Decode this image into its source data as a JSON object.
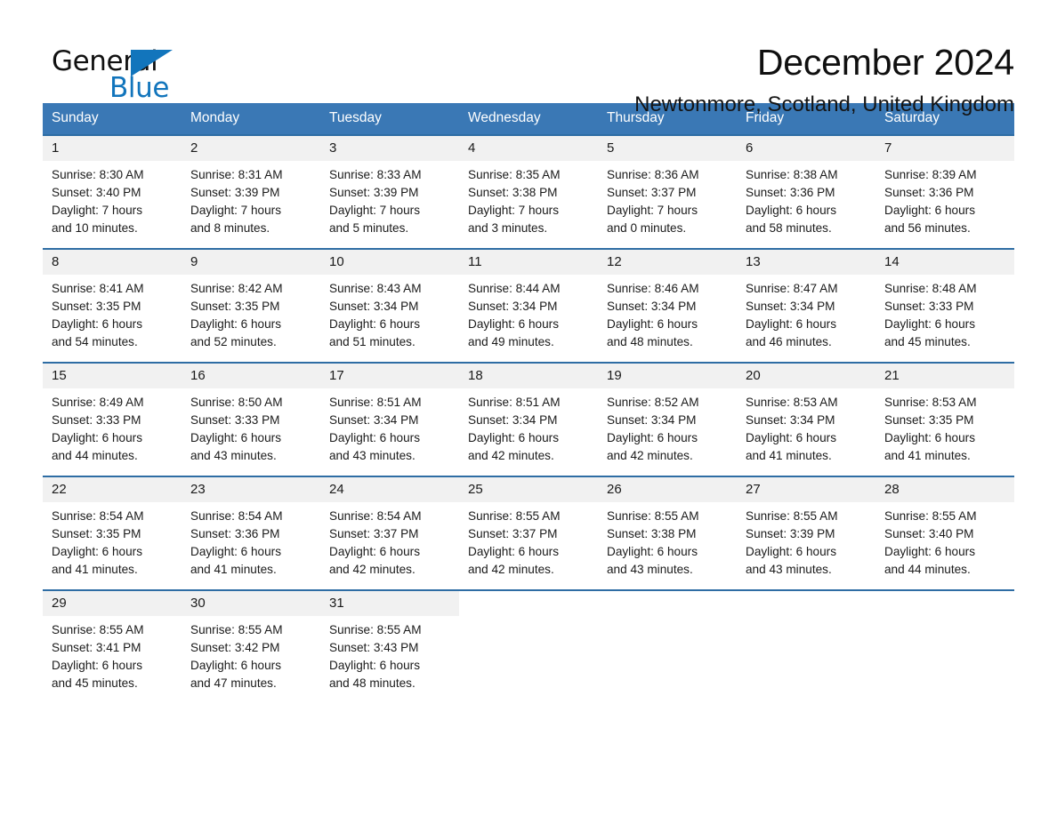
{
  "brand": {
    "name_top": "General",
    "name_bottom": "Blue",
    "accent_color": "#1275bc"
  },
  "header": {
    "title": "December 2024",
    "subtitle": "Newtonmore, Scotland, United Kingdom"
  },
  "theme": {
    "header_blue": "#3a78b5",
    "row_divider_blue": "#2e6da4",
    "date_band_gray": "#f1f1f1"
  },
  "calendar": {
    "weekdays": [
      "Sunday",
      "Monday",
      "Tuesday",
      "Wednesday",
      "Thursday",
      "Friday",
      "Saturday"
    ],
    "weeks": [
      {
        "days": [
          {
            "date": "1",
            "sunrise": "Sunrise: 8:30 AM",
            "sunset": "Sunset: 3:40 PM",
            "daylight_line1": "Daylight: 7 hours",
            "daylight_line2": "and 10 minutes."
          },
          {
            "date": "2",
            "sunrise": "Sunrise: 8:31 AM",
            "sunset": "Sunset: 3:39 PM",
            "daylight_line1": "Daylight: 7 hours",
            "daylight_line2": "and 8 minutes."
          },
          {
            "date": "3",
            "sunrise": "Sunrise: 8:33 AM",
            "sunset": "Sunset: 3:39 PM",
            "daylight_line1": "Daylight: 7 hours",
            "daylight_line2": "and 5 minutes."
          },
          {
            "date": "4",
            "sunrise": "Sunrise: 8:35 AM",
            "sunset": "Sunset: 3:38 PM",
            "daylight_line1": "Daylight: 7 hours",
            "daylight_line2": "and 3 minutes."
          },
          {
            "date": "5",
            "sunrise": "Sunrise: 8:36 AM",
            "sunset": "Sunset: 3:37 PM",
            "daylight_line1": "Daylight: 7 hours",
            "daylight_line2": "and 0 minutes."
          },
          {
            "date": "6",
            "sunrise": "Sunrise: 8:38 AM",
            "sunset": "Sunset: 3:36 PM",
            "daylight_line1": "Daylight: 6 hours",
            "daylight_line2": "and 58 minutes."
          },
          {
            "date": "7",
            "sunrise": "Sunrise: 8:39 AM",
            "sunset": "Sunset: 3:36 PM",
            "daylight_line1": "Daylight: 6 hours",
            "daylight_line2": "and 56 minutes."
          }
        ]
      },
      {
        "days": [
          {
            "date": "8",
            "sunrise": "Sunrise: 8:41 AM",
            "sunset": "Sunset: 3:35 PM",
            "daylight_line1": "Daylight: 6 hours",
            "daylight_line2": "and 54 minutes."
          },
          {
            "date": "9",
            "sunrise": "Sunrise: 8:42 AM",
            "sunset": "Sunset: 3:35 PM",
            "daylight_line1": "Daylight: 6 hours",
            "daylight_line2": "and 52 minutes."
          },
          {
            "date": "10",
            "sunrise": "Sunrise: 8:43 AM",
            "sunset": "Sunset: 3:34 PM",
            "daylight_line1": "Daylight: 6 hours",
            "daylight_line2": "and 51 minutes."
          },
          {
            "date": "11",
            "sunrise": "Sunrise: 8:44 AM",
            "sunset": "Sunset: 3:34 PM",
            "daylight_line1": "Daylight: 6 hours",
            "daylight_line2": "and 49 minutes."
          },
          {
            "date": "12",
            "sunrise": "Sunrise: 8:46 AM",
            "sunset": "Sunset: 3:34 PM",
            "daylight_line1": "Daylight: 6 hours",
            "daylight_line2": "and 48 minutes."
          },
          {
            "date": "13",
            "sunrise": "Sunrise: 8:47 AM",
            "sunset": "Sunset: 3:34 PM",
            "daylight_line1": "Daylight: 6 hours",
            "daylight_line2": "and 46 minutes."
          },
          {
            "date": "14",
            "sunrise": "Sunrise: 8:48 AM",
            "sunset": "Sunset: 3:33 PM",
            "daylight_line1": "Daylight: 6 hours",
            "daylight_line2": "and 45 minutes."
          }
        ]
      },
      {
        "days": [
          {
            "date": "15",
            "sunrise": "Sunrise: 8:49 AM",
            "sunset": "Sunset: 3:33 PM",
            "daylight_line1": "Daylight: 6 hours",
            "daylight_line2": "and 44 minutes."
          },
          {
            "date": "16",
            "sunrise": "Sunrise: 8:50 AM",
            "sunset": "Sunset: 3:33 PM",
            "daylight_line1": "Daylight: 6 hours",
            "daylight_line2": "and 43 minutes."
          },
          {
            "date": "17",
            "sunrise": "Sunrise: 8:51 AM",
            "sunset": "Sunset: 3:34 PM",
            "daylight_line1": "Daylight: 6 hours",
            "daylight_line2": "and 43 minutes."
          },
          {
            "date": "18",
            "sunrise": "Sunrise: 8:51 AM",
            "sunset": "Sunset: 3:34 PM",
            "daylight_line1": "Daylight: 6 hours",
            "daylight_line2": "and 42 minutes."
          },
          {
            "date": "19",
            "sunrise": "Sunrise: 8:52 AM",
            "sunset": "Sunset: 3:34 PM",
            "daylight_line1": "Daylight: 6 hours",
            "daylight_line2": "and 42 minutes."
          },
          {
            "date": "20",
            "sunrise": "Sunrise: 8:53 AM",
            "sunset": "Sunset: 3:34 PM",
            "daylight_line1": "Daylight: 6 hours",
            "daylight_line2": "and 41 minutes."
          },
          {
            "date": "21",
            "sunrise": "Sunrise: 8:53 AM",
            "sunset": "Sunset: 3:35 PM",
            "daylight_line1": "Daylight: 6 hours",
            "daylight_line2": "and 41 minutes."
          }
        ]
      },
      {
        "days": [
          {
            "date": "22",
            "sunrise": "Sunrise: 8:54 AM",
            "sunset": "Sunset: 3:35 PM",
            "daylight_line1": "Daylight: 6 hours",
            "daylight_line2": "and 41 minutes."
          },
          {
            "date": "23",
            "sunrise": "Sunrise: 8:54 AM",
            "sunset": "Sunset: 3:36 PM",
            "daylight_line1": "Daylight: 6 hours",
            "daylight_line2": "and 41 minutes."
          },
          {
            "date": "24",
            "sunrise": "Sunrise: 8:54 AM",
            "sunset": "Sunset: 3:37 PM",
            "daylight_line1": "Daylight: 6 hours",
            "daylight_line2": "and 42 minutes."
          },
          {
            "date": "25",
            "sunrise": "Sunrise: 8:55 AM",
            "sunset": "Sunset: 3:37 PM",
            "daylight_line1": "Daylight: 6 hours",
            "daylight_line2": "and 42 minutes."
          },
          {
            "date": "26",
            "sunrise": "Sunrise: 8:55 AM",
            "sunset": "Sunset: 3:38 PM",
            "daylight_line1": "Daylight: 6 hours",
            "daylight_line2": "and 43 minutes."
          },
          {
            "date": "27",
            "sunrise": "Sunrise: 8:55 AM",
            "sunset": "Sunset: 3:39 PM",
            "daylight_line1": "Daylight: 6 hours",
            "daylight_line2": "and 43 minutes."
          },
          {
            "date": "28",
            "sunrise": "Sunrise: 8:55 AM",
            "sunset": "Sunset: 3:40 PM",
            "daylight_line1": "Daylight: 6 hours",
            "daylight_line2": "and 44 minutes."
          }
        ]
      },
      {
        "days": [
          {
            "date": "29",
            "sunrise": "Sunrise: 8:55 AM",
            "sunset": "Sunset: 3:41 PM",
            "daylight_line1": "Daylight: 6 hours",
            "daylight_line2": "and 45 minutes."
          },
          {
            "date": "30",
            "sunrise": "Sunrise: 8:55 AM",
            "sunset": "Sunset: 3:42 PM",
            "daylight_line1": "Daylight: 6 hours",
            "daylight_line2": "and 47 minutes."
          },
          {
            "date": "31",
            "sunrise": "Sunrise: 8:55 AM",
            "sunset": "Sunset: 3:43 PM",
            "daylight_line1": "Daylight: 6 hours",
            "daylight_line2": "and 48 minutes."
          },
          {
            "date": "",
            "sunrise": "",
            "sunset": "",
            "daylight_line1": "",
            "daylight_line2": ""
          },
          {
            "date": "",
            "sunrise": "",
            "sunset": "",
            "daylight_line1": "",
            "daylight_line2": ""
          },
          {
            "date": "",
            "sunrise": "",
            "sunset": "",
            "daylight_line1": "",
            "daylight_line2": ""
          },
          {
            "date": "",
            "sunrise": "",
            "sunset": "",
            "daylight_line1": "",
            "daylight_line2": ""
          }
        ]
      }
    ]
  }
}
